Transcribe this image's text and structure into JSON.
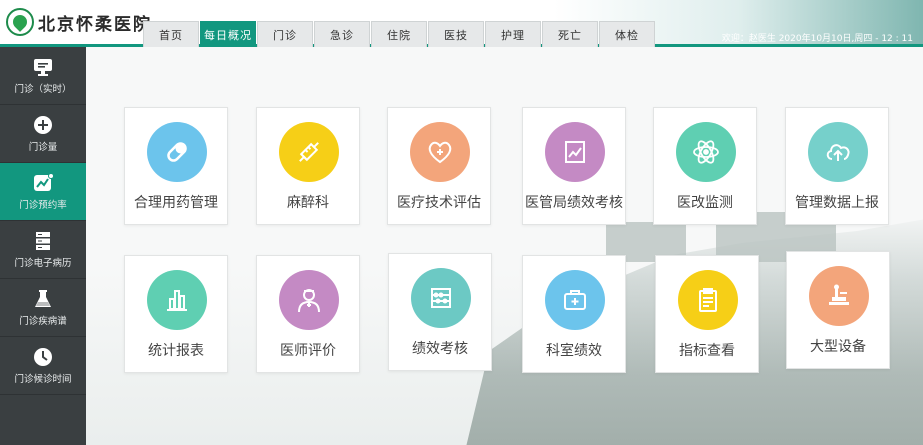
{
  "header": {
    "logo_text": "北京怀柔医院",
    "tabs": [
      "首页",
      "每日概况",
      "门诊",
      "急诊",
      "住院",
      "医技",
      "护理",
      "死亡",
      "体检"
    ],
    "active_tab": 1,
    "status": "欢迎：赵医生  2020年10月10日,周四 - 12 : 11"
  },
  "sidebar": {
    "items": [
      {
        "label": "门诊（实时）",
        "icon": "monitor-icon"
      },
      {
        "label": "门诊量",
        "icon": "plus-circle-icon"
      },
      {
        "label": "门诊预约率",
        "icon": "trend-chart-icon"
      },
      {
        "label": "门诊电子病历",
        "icon": "server-stack-icon"
      },
      {
        "label": "门诊疾病谱",
        "icon": "flask-icon"
      },
      {
        "label": "门诊候诊时间",
        "icon": "clock-icon"
      }
    ],
    "active_index": 2
  },
  "cards": [
    {
      "label": "合理用药管理",
      "color": "#6cc4ec",
      "icon": "pill-icon"
    },
    {
      "label": "麻醉科",
      "color": "#f6cf17",
      "icon": "syringe-icon"
    },
    {
      "label": "医疗技术评估",
      "color": "#f3a57b",
      "icon": "stethoscope-heart-icon"
    },
    {
      "label": "医管局绩效考核",
      "color": "#c48ac4",
      "icon": "chart-board-icon"
    },
    {
      "label": "医改监测",
      "color": "#5fcfb2",
      "icon": "atom-icon"
    },
    {
      "label": "管理数据上报",
      "color": "#76d0cb",
      "icon": "cloud-upload-icon"
    },
    {
      "label": "统计报表",
      "color": "#5fcfb2",
      "icon": "bar-chart-icon"
    },
    {
      "label": "医师评价",
      "color": "#c48ac4",
      "icon": "doctor-icon"
    },
    {
      "label": "绩效考核",
      "color": "#6cc9c4",
      "icon": "abacus-icon"
    },
    {
      "label": "科室绩效",
      "color": "#6cc4ec",
      "icon": "medical-kit-icon"
    },
    {
      "label": "指标查看",
      "color": "#f6cf17",
      "icon": "clipboard-icon"
    },
    {
      "label": "大型设备",
      "color": "#f3a57b",
      "icon": "scanner-icon"
    }
  ]
}
